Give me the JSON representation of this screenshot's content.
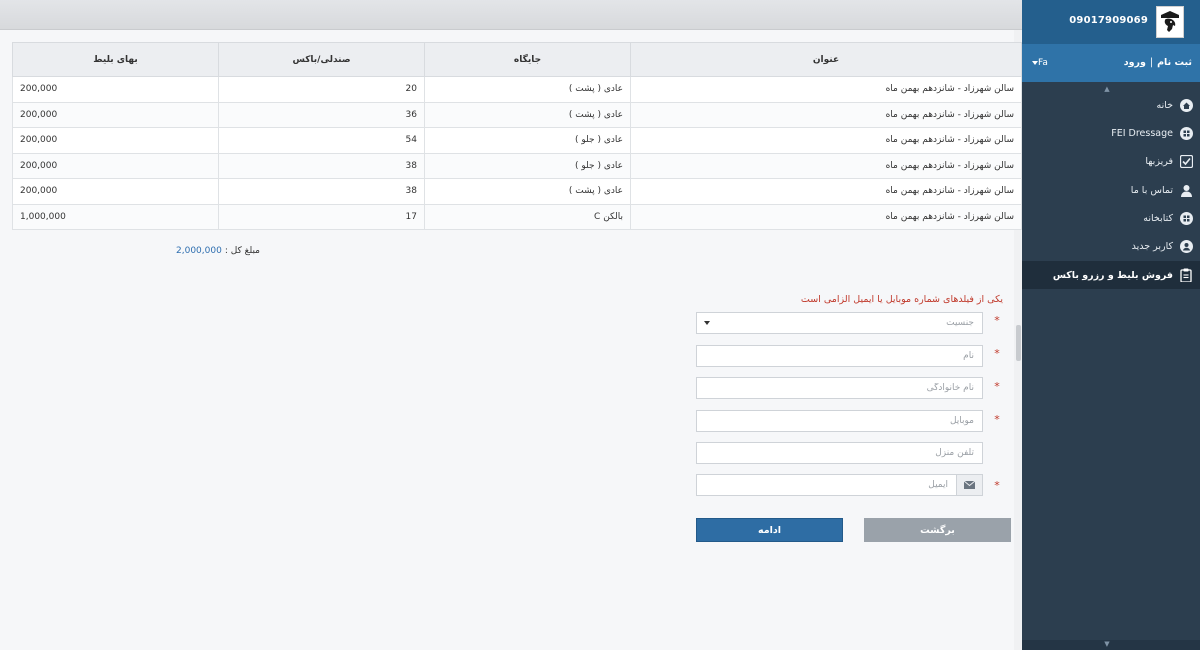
{
  "header": {
    "phone": "09017909069",
    "language": "Fa",
    "register_label": "ثبت نام",
    "login_label": "ورود",
    "separator": "|"
  },
  "sidebar": {
    "items": [
      {
        "label": "خانه",
        "icon": "home-icon"
      },
      {
        "label": "FEI Dressage",
        "icon": "grid-icon"
      },
      {
        "label": "فریزبها",
        "icon": "checkbox-icon"
      },
      {
        "label": "تماس با ما",
        "icon": "user-icon"
      },
      {
        "label": "کتابخانه",
        "icon": "grid-icon"
      },
      {
        "label": "کاربر جدید",
        "icon": "user-circle-icon"
      },
      {
        "label": "فروش بلیط و رزرو باکس",
        "icon": "clipboard-icon",
        "active": true
      }
    ]
  },
  "table": {
    "headers": {
      "price": "بهای بلیط",
      "seat": "صندلی/باکس",
      "position": "جایگاه",
      "title": "عنوان"
    },
    "rows": [
      {
        "price": "200,000",
        "seat": "20",
        "position": "عادی ( پشت )",
        "title": "سالن شهرزاد - شانزدهم بهمن ماه"
      },
      {
        "price": "200,000",
        "seat": "36",
        "position": "عادی ( پشت )",
        "title": "سالن شهرزاد - شانزدهم بهمن ماه"
      },
      {
        "price": "200,000",
        "seat": "54",
        "position": "عادی ( جلو )",
        "title": "سالن شهرزاد - شانزدهم بهمن ماه"
      },
      {
        "price": "200,000",
        "seat": "38",
        "position": "عادی ( جلو )",
        "title": "سالن شهرزاد - شانزدهم بهمن ماه"
      },
      {
        "price": "200,000",
        "seat": "38",
        "position": "عادی ( پشت )",
        "title": "سالن شهرزاد - شانزدهم بهمن ماه"
      },
      {
        "price": "1,000,000",
        "seat": "17",
        "position": "بالکن C",
        "title": "سالن شهرزاد - شانزدهم بهمن ماه"
      }
    ]
  },
  "total": {
    "label": "مبلغ کل :",
    "amount": "2,000,000"
  },
  "form": {
    "required_note": "یکی از فیلدهای شماره موبایل یا ایمیل الزامی است",
    "required_mark": "*",
    "gender_placeholder": "جنسیت",
    "first_name_placeholder": "نام",
    "last_name_placeholder": "نام خانوادگی",
    "mobile_placeholder": "موبایل",
    "home_phone_placeholder": "تلفن منزل",
    "email_placeholder": "ایمیل",
    "continue_label": "ادامه",
    "back_label": "برگشت"
  },
  "colors": {
    "sidebar_bg": "#2c3e4f",
    "header_blue": "#245f8d",
    "primary_button": "#2e6da4",
    "secondary_button": "#9aa2aa",
    "required_red": "#c0392b"
  }
}
